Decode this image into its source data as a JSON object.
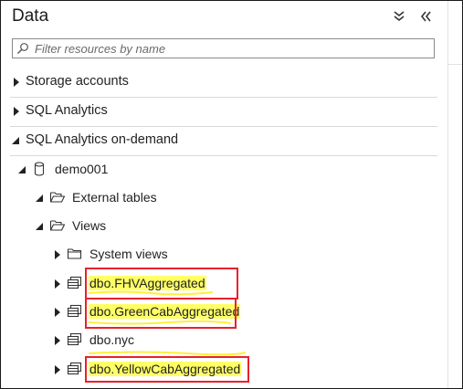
{
  "panel": {
    "title": "Data",
    "collapse_all_icon": "double-chevron-down-icon",
    "collapse_panel_icon": "double-chevron-left-icon"
  },
  "search": {
    "placeholder": "Filter resources by name",
    "value": "",
    "icon": "filter-icon"
  },
  "sections": [
    {
      "label": "Storage accounts",
      "expanded": false
    },
    {
      "label": "SQL Analytics",
      "expanded": false
    },
    {
      "label": "SQL Analytics on-demand",
      "expanded": true
    }
  ],
  "tree": {
    "database": {
      "label": "demo001",
      "icon": "database-icon",
      "expanded": true
    },
    "external_tables": {
      "label": "External tables",
      "icon": "folder-open-icon",
      "expanded": true
    },
    "views": {
      "label": "Views",
      "icon": "folder-open-icon",
      "expanded": true
    },
    "system_views": {
      "label": "System views",
      "icon": "folder-icon",
      "expanded": false
    },
    "items": [
      {
        "label": "dbo.FHVAggregated",
        "icon": "view-icon",
        "highlighted": true
      },
      {
        "label": "dbo.GreenCabAggregated",
        "icon": "view-icon",
        "highlighted": true
      },
      {
        "label": "dbo.nyc",
        "icon": "view-icon",
        "highlighted": false
      },
      {
        "label": "dbo.YellowCabAggregated",
        "icon": "view-icon",
        "highlighted": true
      }
    ]
  },
  "colors": {
    "highlight": "#ffff66",
    "callout_border": "#e8212b",
    "text": "#222222"
  }
}
